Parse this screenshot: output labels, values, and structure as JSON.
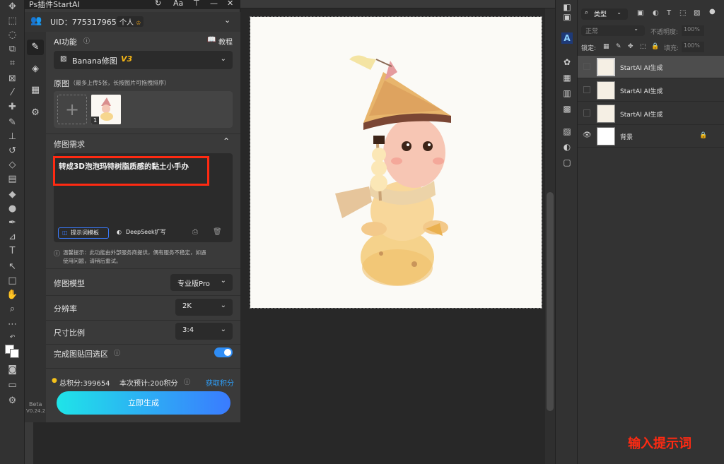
{
  "plugin": {
    "title": "Ps插件StartAI",
    "uid_label": "UID：775317965",
    "account_type": "个人",
    "account_badge": "♔",
    "ai_function_label": "AI功能",
    "tutorial_label": "教程",
    "function_select": {
      "name": "Banana修图",
      "version": "V3"
    },
    "original_label": "原图",
    "original_hint": "（最多上传5张，长按图片可拖拽排序）",
    "image_index": "1",
    "requirement_label": "修图需求",
    "prompt_text": "转成3D泡泡玛特树脂质感的黏土小手办",
    "prompt_template_button": "提示词模板",
    "deepseek_button": "DeepSeek扩写",
    "notice_text_line1": "温馨提示：此功能由外部服务商提供，偶有服务不稳定，如遇",
    "notice_text_line2": "使用问题，请稍后重试。",
    "model_label": "修图模型",
    "model_value": "专业版Pro",
    "resolution_label": "分辨率",
    "resolution_value": "2K",
    "ratio_label": "尺寸比例",
    "ratio_value": "3:4",
    "paste_back_label": "完成图贴回选区",
    "paste_back_on": true,
    "points_total": "总积分:399654",
    "points_estimate": "本次预计:200积分",
    "get_points": "获取积分",
    "generate_button": "立即生成",
    "version_line1": "Beta",
    "version_line2": "V0.24.2"
  },
  "layers": {
    "filter_kind": "类型",
    "blend_mode": "正常",
    "opacity_label": "不透明度:",
    "opacity_value": "100%",
    "lock_label": "锁定:",
    "fill_label": "填充:",
    "fill_value": "100%",
    "items": [
      {
        "name": "StartAI AI生成",
        "selected": true,
        "visible": false
      },
      {
        "name": "StartAI AI生成",
        "selected": false,
        "visible": false
      },
      {
        "name": "StartAI AI生成",
        "selected": false,
        "visible": false
      },
      {
        "name": "背景",
        "selected": false,
        "visible": true,
        "locked": true
      }
    ]
  },
  "overlay_caption": "输入提示词",
  "colors": {
    "accent_cyan": "#1fd4e8",
    "accent_blue": "#3a7bff",
    "highlight_red": "#ff2a12",
    "toggle_on": "#2f8df5",
    "v3_yellow": "#f2b416"
  }
}
